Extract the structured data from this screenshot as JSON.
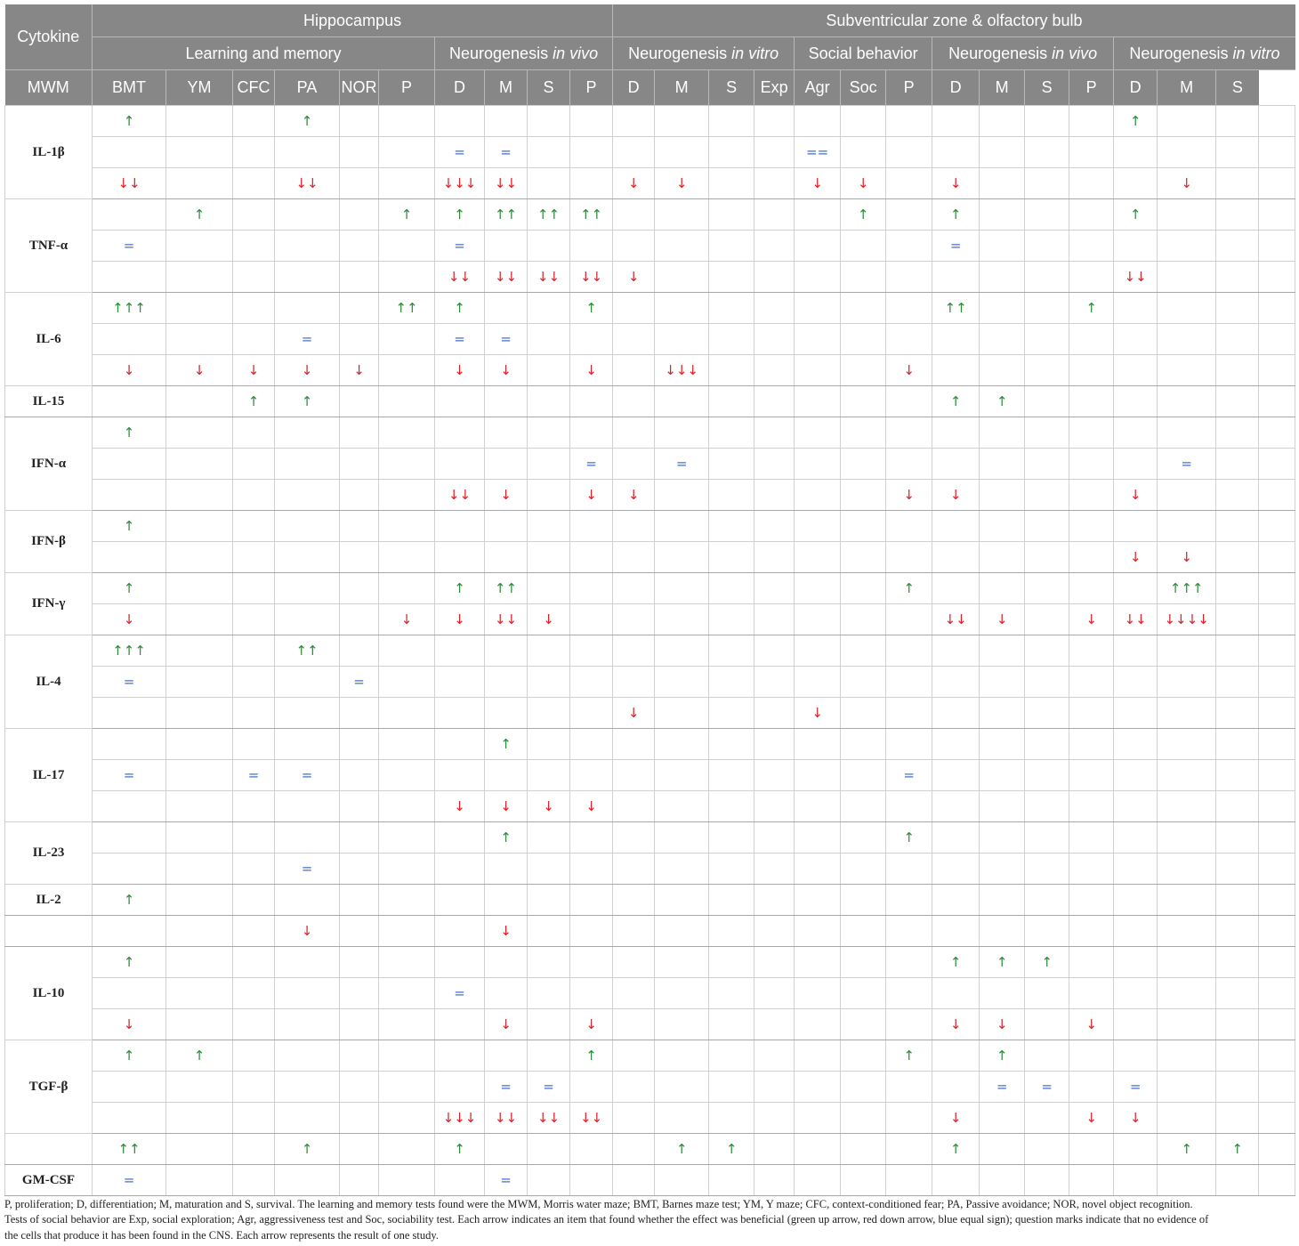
{
  "header": {
    "cytokine_label": "Cytokine",
    "regions": [
      "Hippocampus",
      "Subventricular zone & olfactory bulb"
    ],
    "categories": [
      {
        "name": "Learning and memory",
        "italic": ""
      },
      {
        "name": "Neurogenesis ",
        "italic": "in vivo"
      },
      {
        "name": "Neurogenesis ",
        "italic": "in vitro"
      },
      {
        "name": "Social behavior",
        "italic": ""
      },
      {
        "name": "Neurogenesis ",
        "italic": "in vivo"
      },
      {
        "name": "Neurogenesis ",
        "italic": "in vitro"
      }
    ],
    "columns": [
      "MWM",
      "BMT",
      "YM",
      "CFC",
      "PA",
      "NOR",
      "P",
      "D",
      "M",
      "S",
      "P",
      "D",
      "M",
      "S",
      "Exp",
      "Agr",
      "Soc",
      "P",
      "D",
      "M",
      "S",
      "P",
      "D",
      "M",
      "S"
    ]
  },
  "groups": [
    {
      "name": "IL-1β",
      "rows": [
        {
          "0": "↑",
          "3": "↑",
          "21": "↑"
        },
        {
          "6": "=",
          "7": "=",
          "14": "=="
        },
        {
          "0": "↓↓",
          "3": "↓↓",
          "6": "↓↓↓",
          "7": "↓↓",
          "10": "↓",
          "11": "↓",
          "14": "↓",
          "15": "↓",
          "17": "↓",
          "22": "↓"
        }
      ]
    },
    {
      "name": "TNF-α",
      "rows": [
        {
          "1": "↑",
          "5": "↑",
          "6": "↑",
          "7": "↑↑",
          "8": "↑↑",
          "9": "↑↑",
          "15": "↑",
          "17": "↑",
          "21": "↑"
        },
        {
          "0": "=",
          "6": "=",
          "17": "="
        },
        {
          "6": "↓↓",
          "7": "↓↓",
          "8": "↓↓",
          "9": "↓↓",
          "10": "↓",
          "21": "↓↓"
        }
      ]
    },
    {
      "name": "IL-6",
      "rows": [
        {
          "0": "↑↑↑",
          "5": "↑↑",
          "6": "↑",
          "9": "↑",
          "17": "↑↑",
          "20": "↑"
        },
        {
          "3": "=",
          "6": "=",
          "7": "="
        },
        {
          "0": "↓",
          "1": "↓",
          "2": "↓",
          "3": "↓",
          "4": "↓",
          "6": "↓",
          "7": "↓",
          "9": "↓",
          "11": "↓↓↓",
          "16": "↓"
        }
      ]
    },
    {
      "name": "IL-15",
      "rows": [
        {
          "2": "↑",
          "3": "↑",
          "17": "↑",
          "18": "↑"
        }
      ]
    },
    {
      "name": "IFN-α",
      "rows": [
        {
          "0": "↑"
        },
        {
          "9": "=",
          "11": "=",
          "22": "="
        },
        {
          "6": "↓↓",
          "7": "↓",
          "9": "↓",
          "10": "↓",
          "16": "↓",
          "17": "↓",
          "21": "↓"
        }
      ]
    },
    {
      "name": "IFN-β",
      "rows": [
        {
          "0": "↑"
        },
        {
          "21": "↓",
          "22": "↓"
        }
      ]
    },
    {
      "name": "IFN-γ",
      "rows": [
        {
          "0": "↑",
          "6": "↑",
          "7": "↑↑",
          "16": "↑",
          "22": "↑↑↑"
        },
        {
          "0": "↓",
          "5": "↓",
          "6": "↓",
          "7": "↓↓",
          "8": "↓",
          "17": "↓↓",
          "18": "↓",
          "20": "↓",
          "21": "↓↓",
          "22": "↓↓↓↓"
        }
      ]
    },
    {
      "name": "IL-4",
      "rows": [
        {
          "0": "↑↑↑",
          "3": "↑↑"
        },
        {
          "0": "=",
          "4": "="
        },
        {
          "10": "↓",
          "14": "↓"
        }
      ]
    },
    {
      "name": "IL-17",
      "rows": [
        {
          "7": "↑"
        },
        {
          "0": "=",
          "2": "=",
          "3": "=",
          "16": "="
        },
        {
          "6": "↓",
          "7": "↓",
          "8": "↓",
          "9": "↓"
        }
      ]
    },
    {
      "name": "IL-23",
      "rows": [
        {
          "7": "↑",
          "16": "↑"
        },
        {
          "3": "="
        }
      ]
    },
    {
      "name": "IL-2",
      "rows": [
        {
          "0": "↑"
        }
      ]
    },
    {
      "name": "",
      "rows": [
        {
          "3": "↓",
          "7": "↓"
        }
      ]
    },
    {
      "name": "IL-10",
      "rows": [
        {
          "0": "↑",
          "17": "↑",
          "18": "↑",
          "19": "↑"
        },
        {
          "6": "="
        },
        {
          "0": "↓",
          "7": "↓",
          "9": "↓",
          "17": "↓",
          "18": "↓",
          "20": "↓"
        }
      ]
    },
    {
      "name": "TGF-β",
      "rows": [
        {
          "0": "↑",
          "1": "↑",
          "9": "↑",
          "16": "↑",
          "18": "↑"
        },
        {
          "7": "=",
          "8": "=",
          "18": "=",
          "19": "=",
          "21": "="
        },
        {
          "6": "↓↓↓",
          "7": "↓↓",
          "8": "↓↓",
          "9": "↓↓",
          "17": "↓",
          "20": "↓",
          "21": "↓"
        }
      ]
    },
    {
      "name": "",
      "rows": [
        {
          "0": "↑↑",
          "3": "↑",
          "6": "↑",
          "11": "↑",
          "12": "↑",
          "17": "↑",
          "22": "↑",
          "23": "↑"
        }
      ]
    },
    {
      "name": "GM-CSF",
      "rows": [
        {
          "0": "=",
          "7": "="
        }
      ]
    }
  ],
  "footnote": {
    "line1": "P, proliferation; D, differentiation; M, maturation and S, survival. The learning and memory tests found were the MWM, Morris water maze; BMT, Barnes maze test; YM, Y maze; CFC, context-conditioned fear; PA, Passive avoidance; NOR, novel object recognition.",
    "line2": "Tests of social behavior are Exp, social exploration; Agr, aggressiveness test and Soc, sociability test. Each arrow indicates an item that found whether the effect was beneficial (green up arrow, red down arrow, blue equal sign); question marks indicate that no evidence of",
    "line3": "the cells that produce it has been found in the CNS. Each arrow represents the result of one study."
  },
  "colors": {
    "header_bg": "#878787",
    "up": "#2e8b3a",
    "down": "#d8232a",
    "equal": "#4a6fc9"
  }
}
